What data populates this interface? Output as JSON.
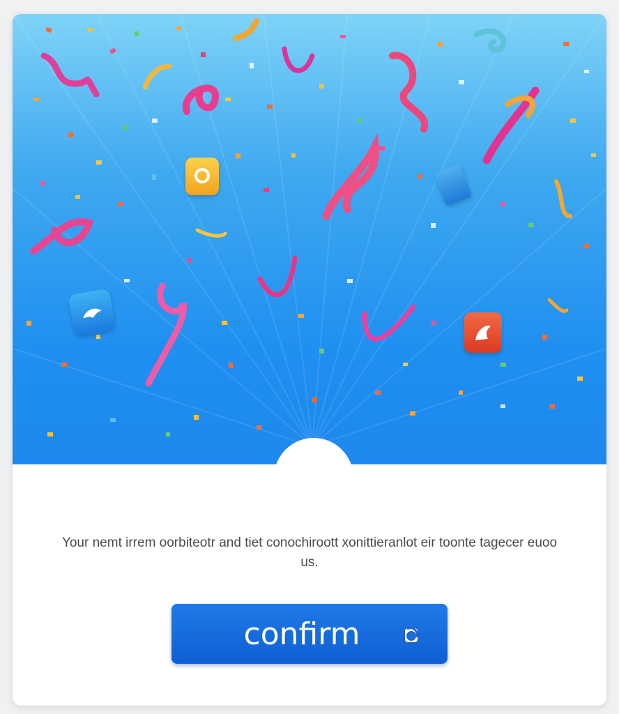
{
  "dialog": {
    "message": "Your nemt irrem oorbiteotr and tiet conochiroott xonittieranlot eir toonte tagecer euoo us.",
    "confirm_label": "confirm",
    "confirm_icon": "copy-icon"
  },
  "colors": {
    "sky_top": "#7fd3f7",
    "sky_bottom": "#1e88ee",
    "button": "#1f7ae6",
    "text": "#4a4a4a"
  },
  "decorations": {
    "hero_icons": [
      "bird-app-icon",
      "chat-app-icon",
      "shark-app-icon",
      "cup-icon"
    ]
  }
}
